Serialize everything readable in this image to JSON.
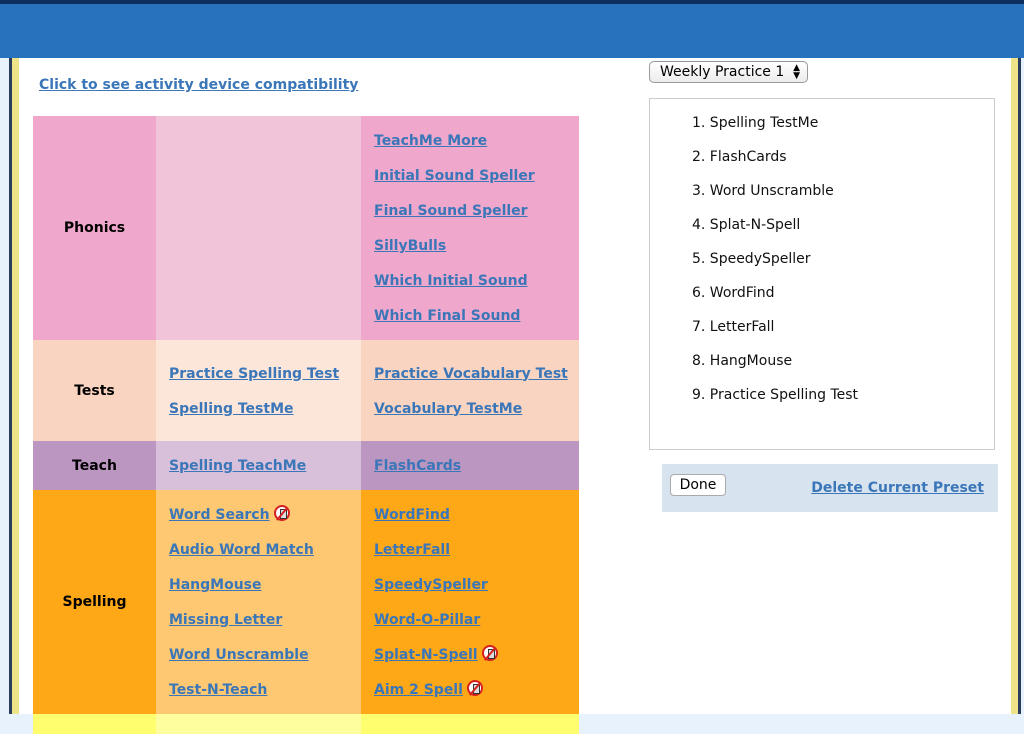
{
  "compat_link": "Click to see activity device compatibility",
  "categories": [
    {
      "name": "Phonics",
      "col1": [],
      "col2": [
        {
          "label": "TeachMe More",
          "no_device": false
        },
        {
          "label": "Initial Sound Speller",
          "no_device": false
        },
        {
          "label": "Final Sound Speller",
          "no_device": false
        },
        {
          "label": "SillyBulls",
          "no_device": false
        },
        {
          "label": "Which Initial Sound",
          "no_device": false
        },
        {
          "label": "Which Final Sound",
          "no_device": false
        }
      ]
    },
    {
      "name": "Tests",
      "col1": [
        {
          "label": "Practice Spelling Test",
          "no_device": false
        },
        {
          "label": "Spelling TestMe",
          "no_device": false
        }
      ],
      "col2": [
        {
          "label": "Practice Vocabulary Test",
          "no_device": false
        },
        {
          "label": "Vocabulary TestMe",
          "no_device": false
        }
      ]
    },
    {
      "name": "Teach",
      "col1": [
        {
          "label": "Spelling TeachMe",
          "no_device": false
        }
      ],
      "col2": [
        {
          "label": "FlashCards",
          "no_device": false
        }
      ]
    },
    {
      "name": "Spelling",
      "col1": [
        {
          "label": "Word Search",
          "no_device": true
        },
        {
          "label": "Audio Word Match",
          "no_device": false
        },
        {
          "label": "HangMouse",
          "no_device": false
        },
        {
          "label": "Missing Letter",
          "no_device": false
        },
        {
          "label": "Word Unscramble",
          "no_device": false
        },
        {
          "label": "Test-N-Teach",
          "no_device": false
        }
      ],
      "col2": [
        {
          "label": "WordFind",
          "no_device": false
        },
        {
          "label": "LetterFall",
          "no_device": false
        },
        {
          "label": "SpeedySpeller",
          "no_device": false
        },
        {
          "label": "Word-O-Pillar",
          "no_device": false
        },
        {
          "label": "Splat-N-Spell",
          "no_device": true
        },
        {
          "label": "Aim 2 Spell",
          "no_device": true
        }
      ]
    }
  ],
  "preset": {
    "selected": "Weekly Practice 1",
    "items": [
      "1. Spelling TestMe",
      "2. FlashCards",
      "3. Word Unscramble",
      "4. Splat-N-Spell",
      "5. SpeedySpeller",
      "6. WordFind",
      "7. LetterFall",
      "8. HangMouse",
      "9. Practice Spelling Test"
    ],
    "done_label": "Done",
    "delete_label": "Delete Current Preset"
  }
}
